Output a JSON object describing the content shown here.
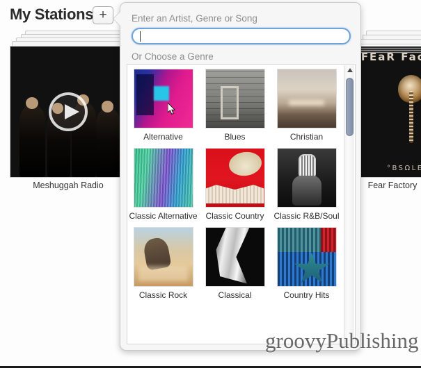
{
  "header": {
    "title": "My Stations",
    "add_button_label": "+"
  },
  "stations": [
    {
      "name": "Meshuggah Radio",
      "art": "band-photo-arch",
      "has_play_button": true
    },
    {
      "name": "Fear Factory",
      "art": "obsolete-album-cover",
      "album_title": "FEaR FacTORY",
      "album_subtitle": "°BSΩLETE"
    }
  ],
  "popover": {
    "artist_label": "Enter an Artist, Genre or Song",
    "genre_label": "Or Choose a Genre",
    "search": {
      "value": "",
      "placeholder": ""
    },
    "scrollbar": {
      "up_arrow": "scroll-up-arrow",
      "thumb_position_pct": 3
    },
    "genres": [
      {
        "name": "Alternative",
        "thumb": "th-alt"
      },
      {
        "name": "Blues",
        "thumb": "th-blues"
      },
      {
        "name": "Christian",
        "thumb": "th-christian"
      },
      {
        "name": "Classic Alternative",
        "thumb": "th-cl-alt"
      },
      {
        "name": "Classic Country",
        "thumb": "th-cl-country"
      },
      {
        "name": "Classic R&B/Soul",
        "thumb": "th-rbsoul"
      },
      {
        "name": "Classic Rock",
        "thumb": "th-cl-rock"
      },
      {
        "name": "Classical",
        "thumb": "th-classical"
      },
      {
        "name": "Country Hits",
        "thumb": "th-country-hits"
      }
    ]
  },
  "watermark": {
    "text": "groovyPublishing"
  },
  "colors": {
    "accent_focus": "#6fa3d8",
    "scroll_thumb": "#8e9bb2",
    "popover_bg": "#f6f6f6",
    "label_gray": "#8d8d8d"
  }
}
